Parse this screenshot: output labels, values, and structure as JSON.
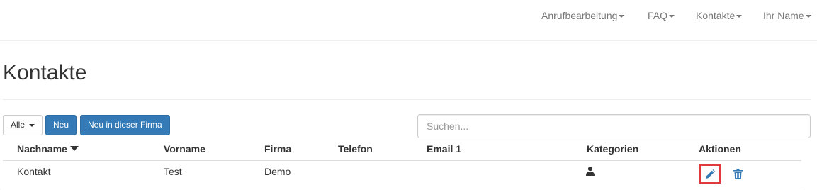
{
  "navbar": {
    "items": [
      {
        "label": "Anrufbearbeitung"
      },
      {
        "label": "FAQ"
      },
      {
        "label": "Kontakte"
      },
      {
        "label": "Ihr Name"
      }
    ]
  },
  "page": {
    "title": "Kontakte"
  },
  "toolbar": {
    "filter_label": "Alle",
    "new_label": "Neu",
    "new_in_company_label": "Neu in dieser Firma"
  },
  "search": {
    "placeholder": "Suchen..."
  },
  "table": {
    "columns": [
      "Nachname",
      "Vorname",
      "Firma",
      "Telefon",
      "Email 1",
      "Kategorien",
      "Aktionen"
    ],
    "sorted_column": "Nachname",
    "sort_direction": "descending",
    "rows": [
      {
        "nachname": "Kontakt",
        "vorname": "Test",
        "firma": "Demo",
        "telefon": "",
        "email": "",
        "kategorie_icon": "person-icon",
        "actions": [
          "pencil-icon",
          "trash-icon"
        ]
      }
    ]
  },
  "colors": {
    "primary": "#337ab7",
    "highlight": "#e0393e",
    "nav_text": "#777777"
  }
}
